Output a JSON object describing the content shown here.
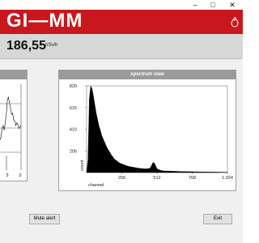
{
  "window": {
    "minimize_glyph": "–",
    "maximize_glyph": "□",
    "close_glyph": "✕"
  },
  "header": {
    "logo_text": "GI—MM",
    "brand_color": "#c8171d",
    "icon": "flame-icon"
  },
  "readout": {
    "value": "186,55",
    "unit": "nSv/h"
  },
  "left_chart": {
    "tick_labels_x": [
      "5",
      "0"
    ]
  },
  "spectrum": {
    "title": "spectrum view",
    "xlabel": "channel",
    "ylabel": "count"
  },
  "buttons": {
    "mute_alert": "Mute alert",
    "exit": "Exit"
  },
  "chart_data": [
    {
      "type": "line",
      "title": "",
      "xlabel": "",
      "ylabel": "",
      "x_tick_labels": [
        "5",
        "0"
      ],
      "series": [
        {
          "x": [
            0,
            1,
            2,
            3,
            4,
            5,
            6,
            7,
            8,
            9,
            10,
            11,
            12,
            13,
            14,
            15,
            16,
            17,
            18,
            19,
            20
          ],
          "y": [
            0.25,
            0.3,
            0.45,
            0.5,
            0.42,
            0.55,
            0.7,
            0.95,
            1.0,
            0.9,
            0.8,
            0.7,
            0.72,
            0.6,
            0.58,
            0.5,
            0.55,
            0.52,
            0.45,
            0.48,
            0.5
          ]
        }
      ]
    },
    {
      "type": "area",
      "title": "spectrum view",
      "xlabel": "channel",
      "ylabel": "count",
      "x_ticks": [
        256,
        512,
        768,
        1024
      ],
      "x_tick_labels": [
        "256",
        "512",
        "768",
        "1.024"
      ],
      "y_ticks": [
        205,
        410,
        615,
        820
      ],
      "y_tick_labels": [
        "205",
        "410",
        "615",
        "820"
      ],
      "xlim": [
        0,
        1024
      ],
      "ylim": [
        0,
        820
      ],
      "grid": false,
      "series": [
        {
          "x": [
            0,
            10,
            20,
            30,
            40,
            50,
            60,
            70,
            80,
            90,
            100,
            110,
            120,
            130,
            140,
            150,
            160,
            170,
            180,
            190,
            200,
            220,
            240,
            260,
            280,
            300,
            320,
            340,
            360,
            380,
            400,
            420,
            440,
            460,
            470,
            480,
            490,
            500,
            510,
            520,
            530,
            540,
            560,
            600,
            640,
            680,
            720,
            760,
            800,
            840,
            880,
            920,
            960,
            1000,
            1024
          ],
          "y": [
            0,
            120,
            700,
            820,
            790,
            720,
            640,
            560,
            500,
            440,
            400,
            350,
            320,
            290,
            260,
            230,
            210,
            190,
            165,
            150,
            130,
            110,
            90,
            80,
            70,
            60,
            55,
            50,
            45,
            40,
            38,
            35,
            35,
            40,
            60,
            90,
            95,
            70,
            40,
            30,
            25,
            20,
            15,
            14,
            12,
            10,
            9,
            8,
            7,
            6,
            5,
            5,
            4,
            3,
            3
          ]
        }
      ]
    }
  ]
}
